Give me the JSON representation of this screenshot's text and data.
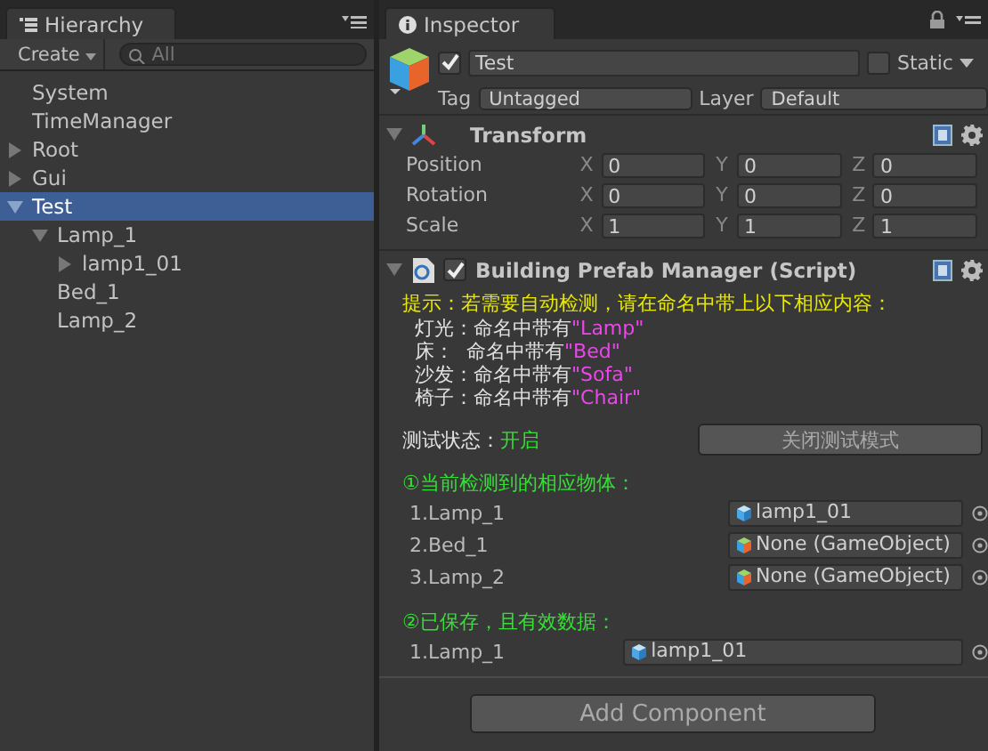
{
  "hierarchy": {
    "tab": "Hierarchy",
    "create_button": "Create",
    "search": {
      "placeholder": "All"
    },
    "items": [
      {
        "label": "System",
        "kind": "leaf",
        "selected": false
      },
      {
        "label": "TimeManager",
        "kind": "leaf",
        "selected": false
      },
      {
        "label": "Root",
        "kind": "group",
        "expanded": false,
        "selected": false
      },
      {
        "label": "Gui",
        "kind": "group",
        "expanded": false,
        "selected": false
      },
      {
        "label": "Test",
        "kind": "group",
        "expanded": true,
        "selected": true,
        "children": [
          {
            "label": "Lamp_1",
            "kind": "group",
            "expanded": true,
            "selected": false,
            "children": [
              {
                "label": "lamp1_01",
                "kind": "group",
                "expanded": false,
                "selected": false
              }
            ]
          },
          {
            "label": "Bed_1",
            "kind": "leaf",
            "selected": false
          },
          {
            "label": "Lamp_2",
            "kind": "leaf",
            "selected": false
          }
        ]
      }
    ]
  },
  "inspector": {
    "tab": "Inspector",
    "active": true,
    "name": "Test",
    "static_label": "Static",
    "static": false,
    "tag_label": "Tag",
    "tag": "Untagged",
    "layer_label": "Layer",
    "layer": "Default",
    "transform": {
      "title": "Transform",
      "expanded": true,
      "rows": [
        {
          "label": "Position",
          "fields": [
            {
              "axis": "X",
              "value": "0"
            },
            {
              "axis": "Y",
              "value": "0"
            },
            {
              "axis": "Z",
              "value": "0"
            }
          ]
        },
        {
          "label": "Rotation",
          "fields": [
            {
              "axis": "X",
              "value": "0"
            },
            {
              "axis": "Y",
              "value": "0"
            },
            {
              "axis": "Z",
              "value": "0"
            }
          ]
        },
        {
          "label": "Scale",
          "fields": [
            {
              "axis": "X",
              "value": "1"
            },
            {
              "axis": "Y",
              "value": "1"
            },
            {
              "axis": "Z",
              "value": "1"
            }
          ]
        }
      ]
    },
    "script": {
      "title": "Building Prefab Manager (Script)",
      "expanded": true,
      "enabled": true,
      "hint": "提示：若需要自动检测，请在命名中带上以下相应内容：",
      "hint_lines": [
        {
          "label": "灯光：",
          "text": "命名中带有",
          "value": "\"Lamp\""
        },
        {
          "label": "床：  ",
          "text": "命名中带有",
          "value": "\"Bed\""
        },
        {
          "label": "沙发：",
          "text": "命名中带有",
          "value": "\"Sofa\""
        },
        {
          "label": "椅子：",
          "text": "命名中带有",
          "value": "\"Chair\""
        }
      ],
      "status_label": "测试状态：",
      "status": "开启",
      "toggle_button": "关闭测试模式",
      "detected_heading": "①当前检测到的相应物体：",
      "detected": [
        {
          "label": "1.Lamp_1",
          "object": "lamp1_01",
          "assigned": true
        },
        {
          "label": "2.Bed_1",
          "object": "None (GameObject)",
          "assigned": false
        },
        {
          "label": "3.Lamp_2",
          "object": "None (GameObject)",
          "assigned": false
        }
      ],
      "saved_heading": "②已保存，且有效数据：",
      "saved": [
        {
          "label": "1.Lamp_1",
          "object": "lamp1_01",
          "assigned": true
        }
      ]
    },
    "add_component_button": "Add Component"
  }
}
